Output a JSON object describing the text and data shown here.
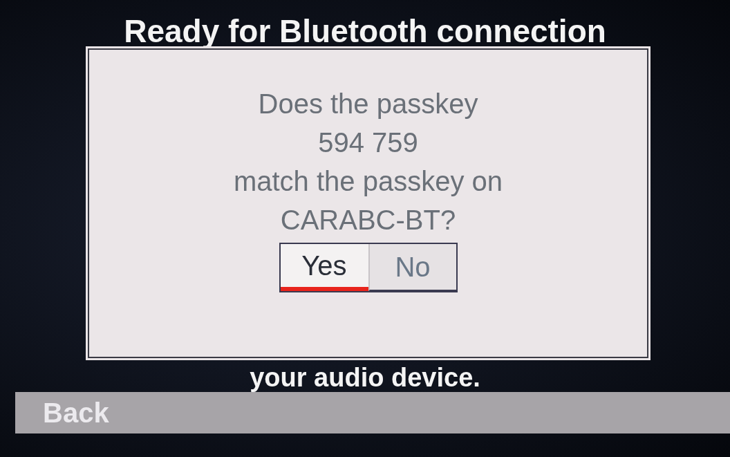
{
  "background_messages": [
    "Ready for Bluetooth connection",
    "your audio device."
  ],
  "dialog": {
    "lines": [
      "Does the passkey",
      "594 759",
      "match the passkey on",
      "CARABC-BT?"
    ],
    "buttons": [
      {
        "label": "Yes",
        "selected": true
      },
      {
        "label": "No",
        "selected": false
      }
    ]
  },
  "back_bar": {
    "label": "Back"
  }
}
